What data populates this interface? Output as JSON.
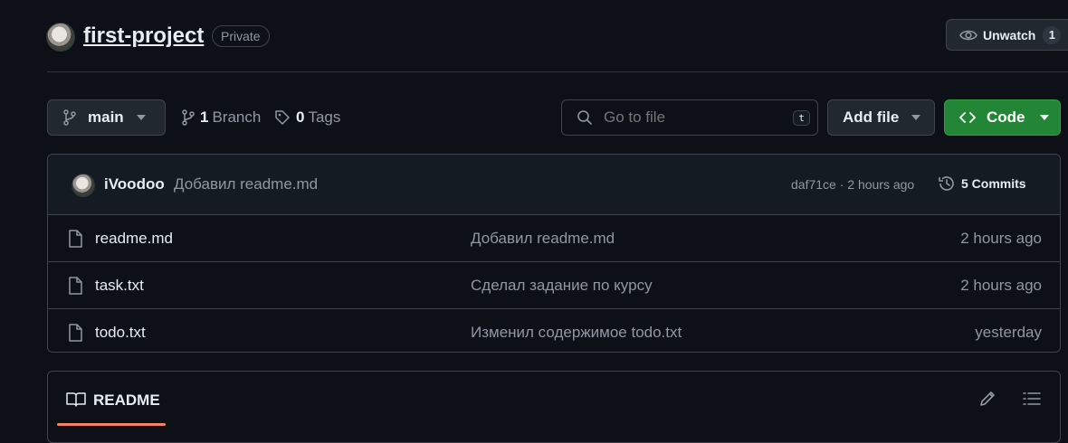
{
  "repo": {
    "name": "first-project",
    "visibility": "Private",
    "watch_label": "Unwatch",
    "watch_count": "1"
  },
  "toolbar": {
    "branch_name": "main",
    "branch_count": "1",
    "branch_label": "Branch",
    "tag_count": "0",
    "tag_label": "Tags",
    "search_placeholder": "Go to file",
    "search_shortcut": "t",
    "add_file_label": "Add file",
    "code_label": "Code"
  },
  "latest_commit": {
    "author": "iVoodoo",
    "message": "Добавил readme.md",
    "meta": "daf71ce · 2 hours ago",
    "commits_label": "5 Commits"
  },
  "files": [
    {
      "name": "readme.md",
      "message": "Добавил readme.md",
      "time": "2 hours ago"
    },
    {
      "name": "task.txt",
      "message": "Сделал задание по курсу",
      "time": "2 hours ago"
    },
    {
      "name": "todo.txt",
      "message": "Изменил содержимое todo.txt",
      "time": "yesterday"
    }
  ],
  "readme": {
    "title": "README"
  },
  "icons": {
    "eye": "eye-icon",
    "branch": "git-branch-icon",
    "tag": "tag-icon",
    "search": "search-icon",
    "code": "code-icon",
    "history": "history-icon",
    "file": "file-icon",
    "book": "book-icon",
    "pencil": "pencil-icon",
    "list": "list-icon"
  },
  "colors": {
    "background": "#0d1117",
    "accent_green": "#238636",
    "readme_tab_underline": "#f78166"
  }
}
